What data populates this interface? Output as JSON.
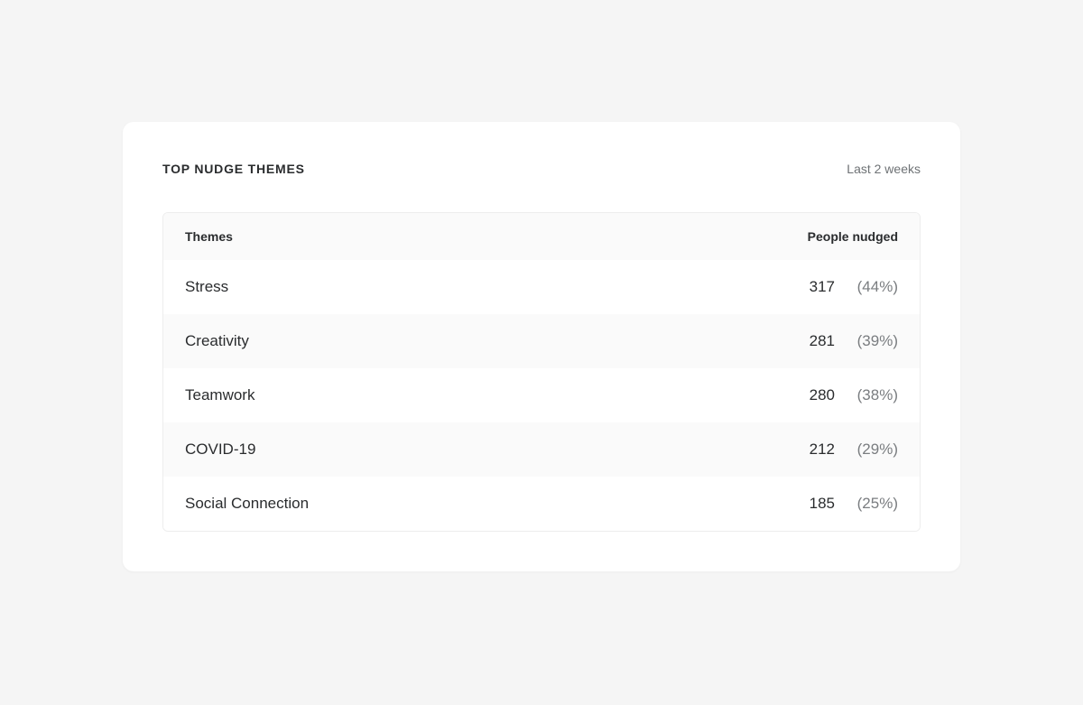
{
  "card": {
    "title": "TOP NUDGE THEMES",
    "subtitle": "Last 2 weeks"
  },
  "table": {
    "headers": {
      "theme": "Themes",
      "people": "People nudged"
    },
    "rows": [
      {
        "theme": "Stress",
        "count": "317",
        "percent": "(44%)"
      },
      {
        "theme": "Creativity",
        "count": "281",
        "percent": "(39%)"
      },
      {
        "theme": "Teamwork",
        "count": "280",
        "percent": "(38%)"
      },
      {
        "theme": "COVID-19",
        "count": "212",
        "percent": "(29%)"
      },
      {
        "theme": "Social Connection",
        "count": "185",
        "percent": "(25%)"
      }
    ]
  },
  "chart_data": {
    "type": "table",
    "title": "Top Nudge Themes",
    "time_range": "Last 2 weeks",
    "columns": [
      "Themes",
      "People nudged (count)",
      "People nudged (percent)"
    ],
    "rows": [
      [
        "Stress",
        317,
        44
      ],
      [
        "Creativity",
        281,
        39
      ],
      [
        "Teamwork",
        280,
        38
      ],
      [
        "COVID-19",
        212,
        29
      ],
      [
        "Social Connection",
        185,
        25
      ]
    ]
  }
}
